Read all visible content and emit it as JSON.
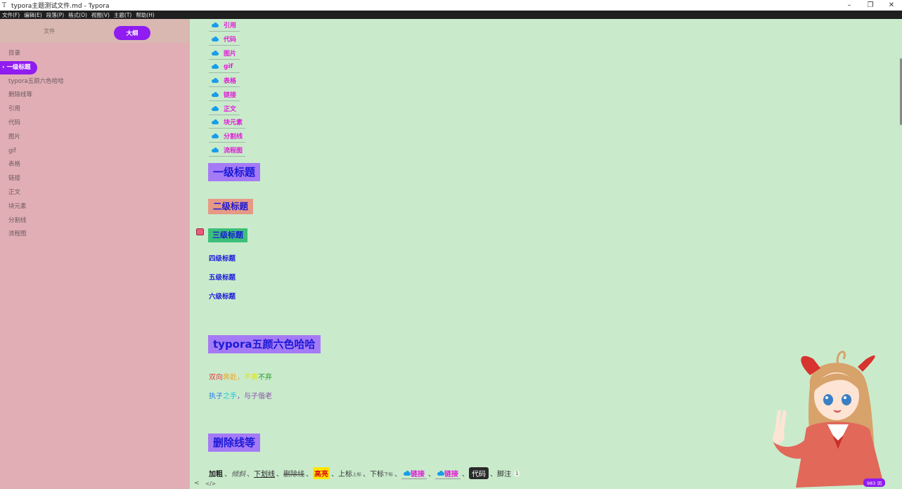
{
  "window": {
    "title": "typora主题测试文件.md - Typora",
    "controls": {
      "minimize": "–",
      "maximize": "❐",
      "close": "✕"
    }
  },
  "menu": [
    "文件(F)",
    "编辑(E)",
    "段落(P)",
    "格式(O)",
    "视图(V)",
    "主题(T)",
    "帮助(H)"
  ],
  "sidebar": {
    "tab_files": "文件",
    "tab_outline": "大纲",
    "items": [
      {
        "label": "目录"
      },
      {
        "label": "一级标题",
        "active": true
      },
      {
        "label": "typora五颜六色哈哈"
      },
      {
        "label": "删除线等"
      },
      {
        "label": "引用"
      },
      {
        "label": "代码"
      },
      {
        "label": "图片"
      },
      {
        "label": "gif"
      },
      {
        "label": "表格"
      },
      {
        "label": "链接"
      },
      {
        "label": "正文"
      },
      {
        "label": "块元素"
      },
      {
        "label": "分割线"
      },
      {
        "label": "流程图"
      }
    ]
  },
  "toc": [
    "引用",
    "代码",
    "图片",
    "gif",
    "表格",
    "链接",
    "正文",
    "块元素",
    "分割线",
    "流程图"
  ],
  "headings": {
    "h1": "一级标题",
    "h2": "二级标题",
    "h3": "三级标题",
    "h4": "四级标题",
    "h5": "五级标题",
    "h6": "六级标题",
    "section2": "typora五颜六色哈哈",
    "section3": "删除线等"
  },
  "colorful": {
    "line1": [
      {
        "text": "双向",
        "color": "red"
      },
      {
        "text": "奔赴",
        "color": "orange"
      },
      {
        "text": "，",
        "color": "orange"
      },
      {
        "text": "不离",
        "color": "yellow"
      },
      {
        "text": "不弃",
        "color": "green"
      }
    ],
    "line2": [
      {
        "text": "执子",
        "color": "blue"
      },
      {
        "text": "之手",
        "color": "cyan"
      },
      {
        "text": "，与子偕老",
        "color": "purple"
      }
    ]
  },
  "formatting": {
    "bold": "加粗",
    "italic": "倾斜",
    "underline": "下划线",
    "strike": "删除线",
    "highlight": "高亮",
    "sup_prefix": "上标",
    "sup": "上标",
    "sub_prefix": "下标",
    "sub": "下标",
    "link1": "链接",
    "link2": "链接",
    "code": "代码",
    "footnote": "脚注",
    "footnote_num": "1",
    "sep": "、"
  },
  "status": {
    "back_icon": "<",
    "source_icon": "</>",
    "word_count": "983 词"
  }
}
